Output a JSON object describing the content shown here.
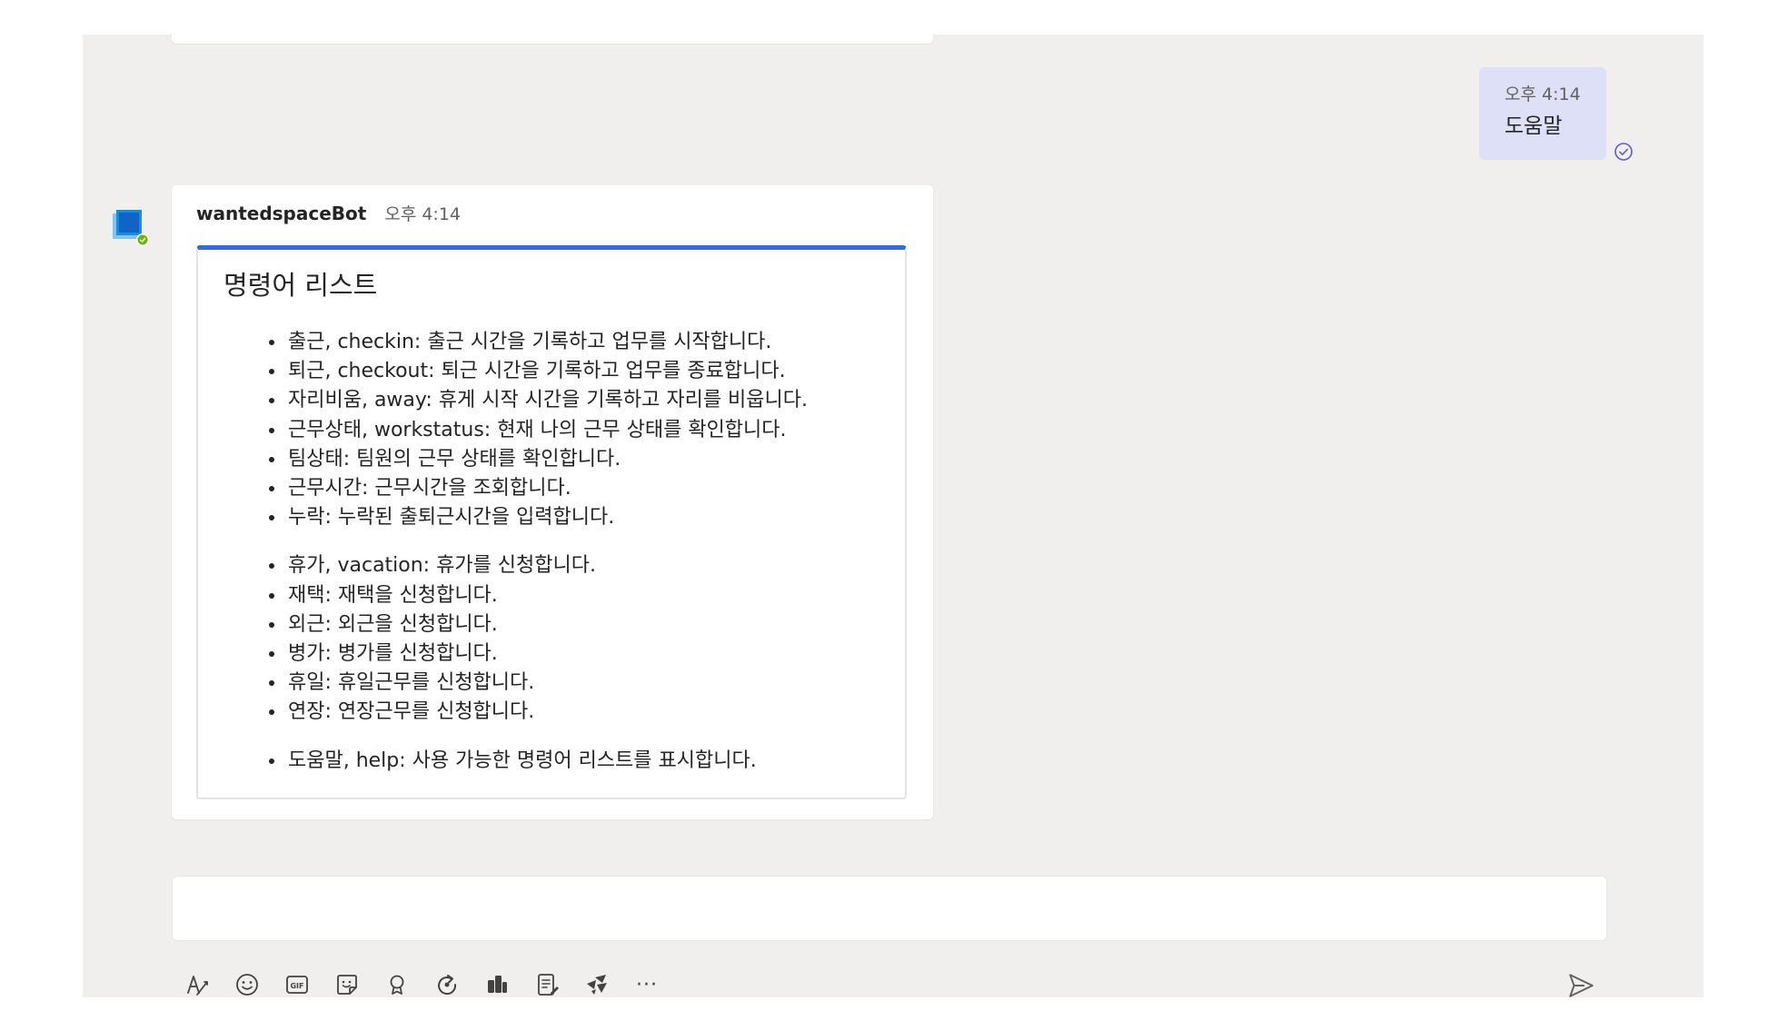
{
  "sent_message": {
    "time": "오후 4:14",
    "text": "도움말"
  },
  "bot_message": {
    "sender": "wantedspaceBot",
    "time": "오후 4:14",
    "card": {
      "title": "명령어 리스트",
      "items": [
        "출근, checkin: 출근 시간을 기록하고 업무를 시작합니다.",
        "퇴근, checkout: 퇴근 시간을 기록하고 업무를 종료합니다.",
        "자리비움, away: 휴게 시작 시간을 기록하고 자리를 비웁니다.",
        "근무상태, workstatus: 현재 나의 근무 상태를 확인합니다.",
        "팀상태: 팀원의 근무 상태를 확인합니다.",
        "근무시간: 근무시간을 조회합니다.",
        "누락: 누락된 출퇴근시간을 입력합니다.",
        "휴가, vacation: 휴가를 신청합니다.",
        "재택: 재택을 신청합니다.",
        "외근: 외근을 신청합니다.",
        "병가: 병가를 신청합니다.",
        "휴일: 휴일근무를 신청합니다.",
        "연장: 연장근무를 신청합니다.",
        "도움말, help: 사용 가능한 명령어 리스트를 표시합니다."
      ]
    }
  },
  "composer": {
    "toolbar_icons": [
      "format-icon",
      "emoji-icon",
      "gif-icon",
      "sticker-icon",
      "praise-icon",
      "loop-icon",
      "app-icon",
      "forms-icon",
      "wantedspace-icon",
      "more-icon"
    ],
    "more_label": "···",
    "gif_label": "GIF"
  },
  "colors": {
    "accent": "#2f6dd8",
    "sent_bubble": "#dde0f7",
    "background": "#f0efee",
    "avatar_blue": "#1a8cd8",
    "presence_green": "#6bb700"
  }
}
